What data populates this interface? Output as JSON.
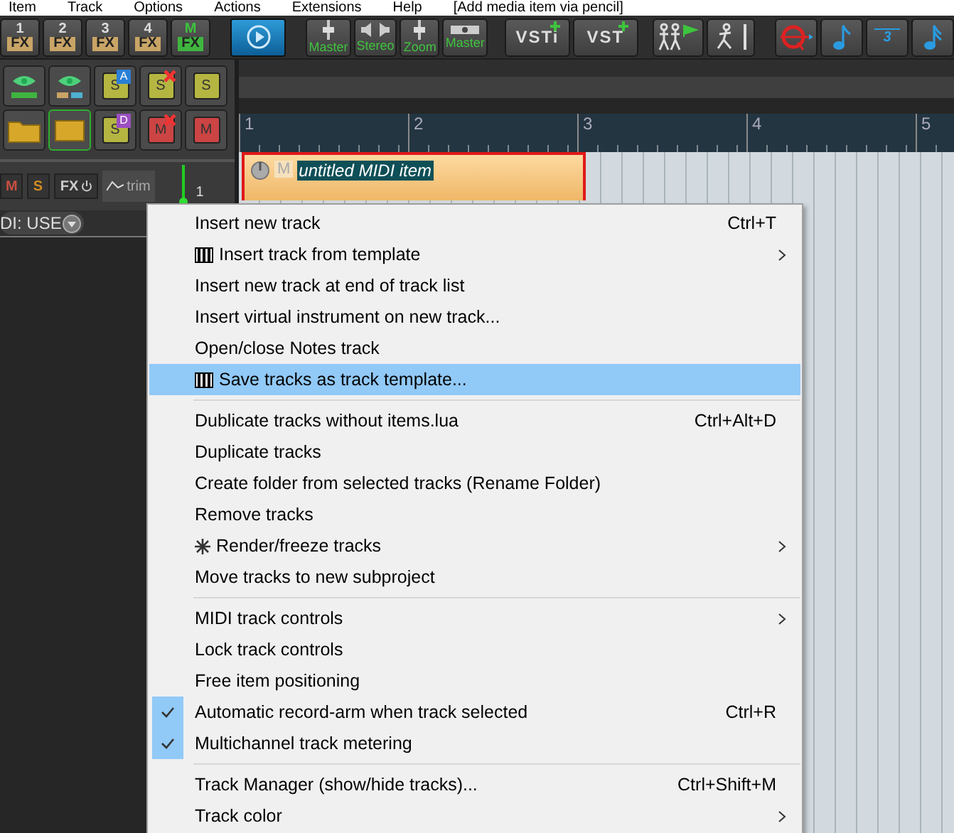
{
  "menu_bar": {
    "items": [
      "Item",
      "Track",
      "Options",
      "Actions",
      "Extensions",
      "Help",
      "[Add media item via pencil]"
    ]
  },
  "toolbar": {
    "fx_buttons": [
      {
        "number": "1",
        "label": "FX",
        "kind": "plain"
      },
      {
        "number": "2",
        "label": "FX",
        "kind": "plain"
      },
      {
        "number": "3",
        "label": "FX",
        "kind": "plain"
      },
      {
        "number": "4",
        "label": "FX",
        "kind": "plain"
      },
      {
        "number": "M",
        "label": "FX",
        "kind": "master"
      }
    ],
    "view_buttons": [
      {
        "label": "Master",
        "kind": "fader"
      },
      {
        "label": "Stereo",
        "kind": "speaker"
      },
      {
        "label": "Zoom",
        "kind": "fader"
      },
      {
        "label": "Master",
        "kind": "width"
      }
    ],
    "vst_buttons": [
      "VSTi",
      "VST"
    ],
    "tool_icons": [
      {
        "kind": "walkers"
      },
      {
        "kind": "runner"
      },
      {
        "kind": "quantize"
      },
      {
        "kind": "note"
      },
      {
        "kind": "triplet",
        "label": "3"
      },
      {
        "kind": "dotted"
      }
    ]
  },
  "track_panel_buttons": [
    {
      "kind": "eye"
    },
    {
      "kind": "eyes"
    },
    {
      "kind": "solo",
      "label": "S",
      "badge": "A",
      "color": "#2a7fd6"
    },
    {
      "kind": "solo",
      "label": "S",
      "cross": true
    },
    {
      "kind": "solo",
      "label": "S"
    },
    {
      "kind": "folder"
    },
    {
      "kind": "collapsed"
    },
    {
      "kind": "solo",
      "label": "S",
      "badge": "D",
      "color": "#9b4fc0"
    },
    {
      "kind": "mute",
      "label": "M",
      "cross": true
    },
    {
      "kind": "mute",
      "label": "M"
    }
  ],
  "track_header": {
    "mute": "M",
    "solo": "S",
    "fx": "FX",
    "trim": "trim",
    "number": "1",
    "input": "DI: USE"
  },
  "ruler": {
    "marks": [
      "1",
      "2",
      "3",
      "4",
      "5"
    ]
  },
  "midi_item": {
    "mute": "M",
    "name": "untitled MIDI item"
  },
  "context_menu": {
    "sections": [
      [
        {
          "label": "Insert new track",
          "shortcut": "Ctrl+T",
          "kind": "plain",
          "submenu": false,
          "checked": false,
          "selected": false
        },
        {
          "label": "Insert track from template",
          "kind": "template",
          "submenu": true,
          "checked": false,
          "selected": false
        },
        {
          "label": "Insert new track at end of track list",
          "kind": "plain",
          "submenu": false,
          "checked": false,
          "selected": false
        },
        {
          "label": "Insert virtual instrument on new track...",
          "kind": "plain",
          "submenu": false,
          "checked": false,
          "selected": false
        },
        {
          "label": "Open/close Notes track",
          "kind": "plain",
          "submenu": false,
          "checked": false,
          "selected": false
        },
        {
          "label": "Save tracks as track template...",
          "kind": "template",
          "submenu": false,
          "checked": false,
          "selected": true
        }
      ],
      [
        {
          "label": "Dublicate tracks without items.lua",
          "shortcut": "Ctrl+Alt+D",
          "kind": "plain",
          "submenu": false,
          "checked": false,
          "selected": false
        },
        {
          "label": "Duplicate tracks",
          "kind": "plain",
          "submenu": false,
          "checked": false,
          "selected": false
        },
        {
          "label": "Create folder from selected tracks (Rename Folder)",
          "kind": "plain",
          "submenu": false,
          "checked": false,
          "selected": false
        },
        {
          "label": "Remove tracks",
          "kind": "plain",
          "submenu": false,
          "checked": false,
          "selected": false
        },
        {
          "label": "Render/freeze tracks",
          "kind": "render",
          "submenu": true,
          "checked": false,
          "selected": false
        },
        {
          "label": "Move tracks to new subproject",
          "kind": "plain",
          "submenu": false,
          "checked": false,
          "selected": false
        }
      ],
      [
        {
          "label": "MIDI track controls",
          "kind": "plain",
          "submenu": true,
          "checked": false,
          "selected": false
        },
        {
          "label": "Lock track controls",
          "kind": "plain",
          "submenu": false,
          "checked": false,
          "selected": false
        },
        {
          "label": "Free item positioning",
          "kind": "plain",
          "submenu": false,
          "checked": false,
          "selected": false
        },
        {
          "label": "Automatic record-arm when track selected",
          "shortcut": "Ctrl+R",
          "kind": "plain",
          "submenu": false,
          "checked": true,
          "selected": false
        },
        {
          "label": "Multichannel track metering",
          "kind": "plain",
          "submenu": false,
          "checked": true,
          "selected": false
        }
      ],
      [
        {
          "label": "Track Manager (show/hide tracks)...",
          "shortcut": "Ctrl+Shift+M",
          "kind": "plain",
          "submenu": false,
          "checked": false,
          "selected": false
        },
        {
          "label": "Track color",
          "kind": "plain",
          "submenu": true,
          "checked": false,
          "selected": false
        }
      ]
    ]
  }
}
